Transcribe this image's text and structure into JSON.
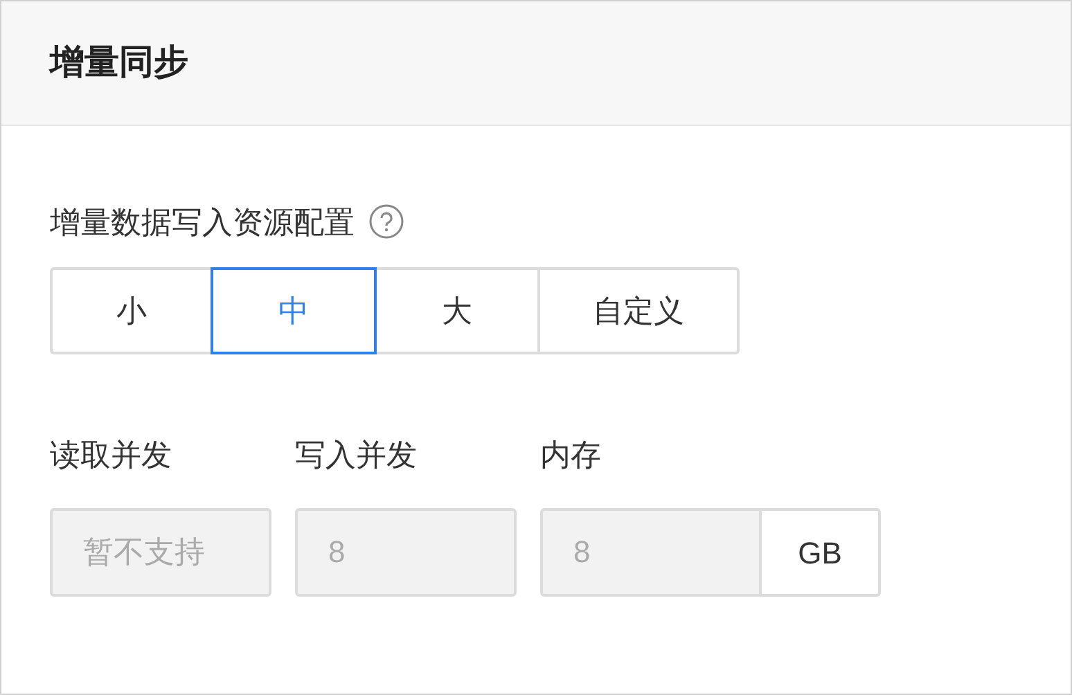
{
  "header": {
    "title": "增量同步"
  },
  "section": {
    "label": "增量数据写入资源配置",
    "help": true
  },
  "sizes": [
    {
      "label": "小",
      "selected": false
    },
    {
      "label": "中",
      "selected": true
    },
    {
      "label": "大",
      "selected": false
    },
    {
      "label": "自定义",
      "selected": false
    }
  ],
  "fields": [
    {
      "label": "读取并发",
      "placeholder": "暂不支持",
      "disabled": true
    },
    {
      "label": "写入并发",
      "value": "8",
      "disabled": true
    },
    {
      "label": "内存",
      "value": "8",
      "disabled": true,
      "suffix": "GB"
    }
  ]
}
